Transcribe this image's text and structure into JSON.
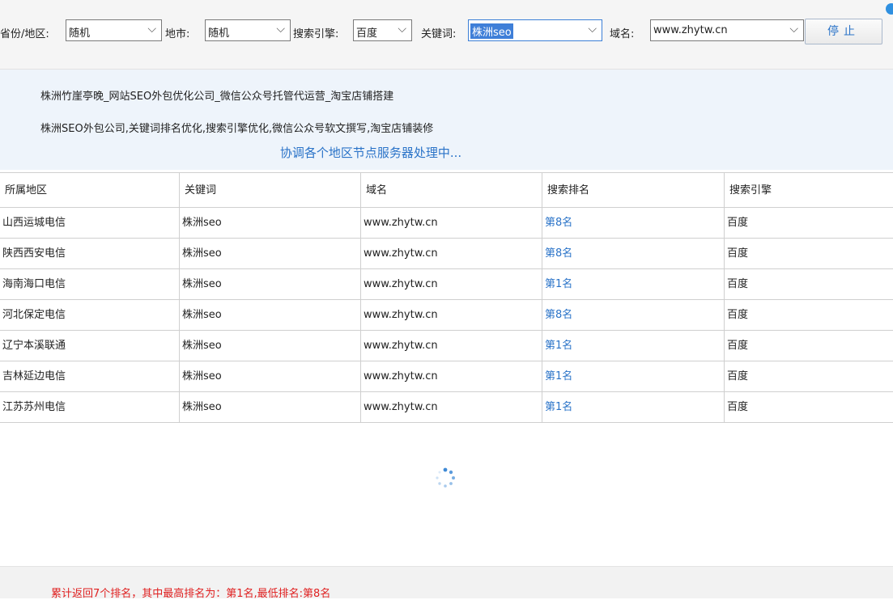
{
  "toolbar": {
    "province_label": "省份/地区:",
    "province_value": "随机",
    "city_label": "地市:",
    "city_value": "随机",
    "engine_label": "搜索引擎:",
    "engine_value": "百度",
    "keyword_label": "关键词:",
    "keyword_value": "株洲seo",
    "domain_label": "域名:",
    "domain_value": "www.zhytw.cn",
    "stop_label": "停止"
  },
  "info": {
    "title_line": "株洲竹崖亭晚_网站SEO外包优化公司_微信公众号托管代运营_淘宝店铺搭建",
    "description_line": "株洲SEO外包公司,关键词排名优化,搜索引擎优化,微信公众号软文撰写,淘宝店铺装修",
    "status": "协调各个地区节点服务器处理中..."
  },
  "table": {
    "headers": [
      "所属地区",
      "关键词",
      "域名",
      "搜索排名",
      "搜索引擎"
    ],
    "rows": [
      [
        "山西运城电信",
        "株洲seo",
        "www.zhytw.cn",
        "第8名",
        "百度"
      ],
      [
        "陕西西安电信",
        "株洲seo",
        "www.zhytw.cn",
        "第8名",
        "百度"
      ],
      [
        "海南海口电信",
        "株洲seo",
        "www.zhytw.cn",
        "第1名",
        "百度"
      ],
      [
        "河北保定电信",
        "株洲seo",
        "www.zhytw.cn",
        "第8名",
        "百度"
      ],
      [
        "辽宁本溪联通",
        "株洲seo",
        "www.zhytw.cn",
        "第1名",
        "百度"
      ],
      [
        "吉林延边电信",
        "株洲seo",
        "www.zhytw.cn",
        "第1名",
        "百度"
      ],
      [
        "江苏苏州电信",
        "株洲seo",
        "www.zhytw.cn",
        "第1名",
        "百度"
      ]
    ]
  },
  "footer": {
    "summary": "累计返回7个排名，其中最高排名为：第1名,最低排名:第8名"
  },
  "colors": {
    "accent": "#2a73c8",
    "summary_red": "#e02020"
  },
  "icons": {
    "dropdown": "chevron-down-icon",
    "loading": "loading-spinner-icon"
  }
}
